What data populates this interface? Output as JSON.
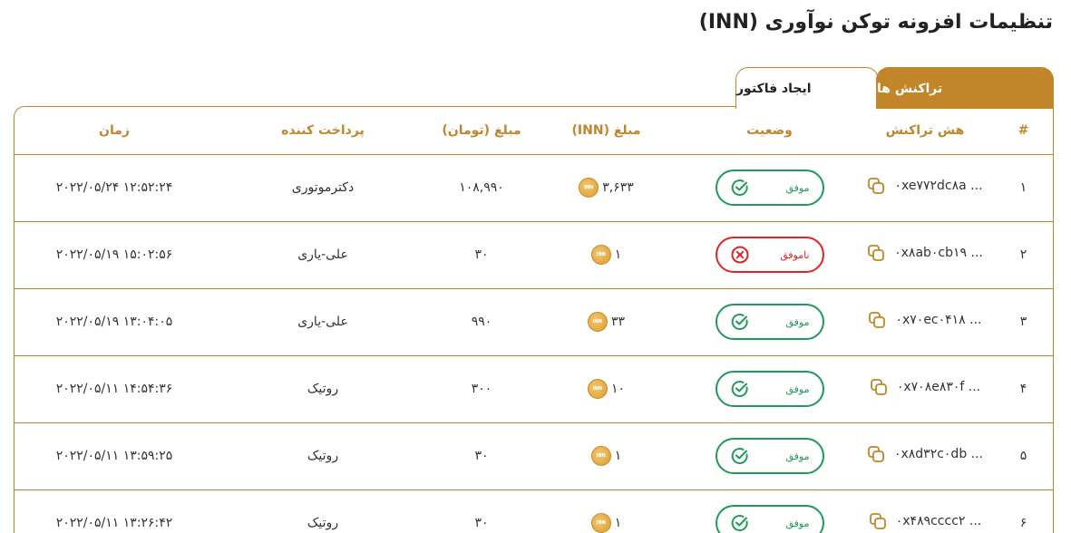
{
  "page_title": "تنظیمات افزونه توکن نوآوری (INN)",
  "tabs": [
    {
      "label": "تراکنش ها",
      "active": true
    },
    {
      "label": "ایجاد فاکتور",
      "active": false
    }
  ],
  "table": {
    "headers": {
      "num": "#",
      "hash": "هش تراکنش",
      "status": "وضعیت",
      "amount_inn": "مبلغ (INN)",
      "amount_toman": "مبلغ (تومان)",
      "payer": "پرداخت کننده",
      "time": "زمان"
    },
    "rows": [
      {
        "num": "۱",
        "hash": "۰xe۷۷۲dc۸a ...",
        "status": "موفق",
        "status_type": "success",
        "amount_inn": "۳,۶۳۳",
        "amount_toman": "۱۰۸,۹۹۰",
        "payer": "دکترموتوری",
        "time": "۲۰۲۲/۰۵/۲۴ ۱۲:۵۲:۲۴"
      },
      {
        "num": "۲",
        "hash": "۰x۸ab۰cb۱۹ ...",
        "status": "ناموفق",
        "status_type": "failed",
        "amount_inn": "۱",
        "amount_toman": "۳۰",
        "payer": "علی-یاری",
        "time": "۲۰۲۲/۰۵/۱۹ ۱۵:۰۲:۵۶"
      },
      {
        "num": "۳",
        "hash": "۰x۷۰ec۰۴۱۸ ...",
        "status": "موفق",
        "status_type": "success",
        "amount_inn": "۳۳",
        "amount_toman": "۹۹۰",
        "payer": "علی-یاری",
        "time": "۲۰۲۲/۰۵/۱۹ ۱۳:۰۴:۰۵"
      },
      {
        "num": "۴",
        "hash": "۰x۷۰۸e۸۳۰f ...",
        "status": "موفق",
        "status_type": "success",
        "amount_inn": "۱۰",
        "amount_toman": "۳۰۰",
        "payer": "روتیک",
        "time": "۲۰۲۲/۰۵/۱۱ ۱۴:۵۴:۳۶"
      },
      {
        "num": "۵",
        "hash": "۰x۸d۳۲c۰db ...",
        "status": "موفق",
        "status_type": "success",
        "amount_inn": "۱",
        "amount_toman": "۳۰",
        "payer": "روتیک",
        "time": "۲۰۲۲/۰۵/۱۱ ۱۳:۵۹:۲۵"
      },
      {
        "num": "۶",
        "hash": "۰x۴۸۹cccc۲ ...",
        "status": "موفق",
        "status_type": "success",
        "amount_inn": "۱",
        "amount_toman": "۳۰",
        "payer": "روتیک",
        "time": "۲۰۲۲/۰۵/۱۱ ۱۳:۲۶:۴۲"
      }
    ]
  },
  "icons": {
    "copy": "copy-icon",
    "success": "check-circle-icon",
    "failed": "x-circle-icon",
    "coin": "inn-coin-icon"
  },
  "colors": {
    "accent": "#c1862a",
    "success": "#1e9a5a",
    "failed": "#e02424"
  }
}
